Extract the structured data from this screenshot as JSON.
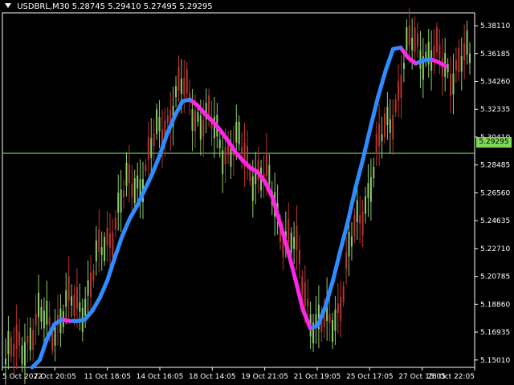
{
  "chart_title": {
    "symbol_period": "USDBRL,M30",
    "ohlc": [
      "5.28745",
      "5.29410",
      "5.27495",
      "5.29295"
    ]
  },
  "current_price_label": "5.29295",
  "colors": {
    "background": "#000000",
    "frame": "#ffffff",
    "bull_candle": "#8ecb6a",
    "bear_candle": "#b7352f",
    "current_line": "#63d85a",
    "indicator_up": "#2f8cff",
    "indicator_down": "#ff27e6",
    "text": "#ffffff"
  },
  "chart_data": {
    "type": "line",
    "title": "USDBRL,M30 5.28745 5.29410 5.27495 5.29295",
    "x": [
      "5 Oct 2022",
      "7 Oct 20:05",
      "11 Oct 18:05",
      "14 Oct 16:05",
      "18 Oct 14:05",
      "19 Oct 21:05",
      "21 Oct 19:05",
      "25 Oct 17:05",
      "27 Oct 15:05",
      "28 Oct 22:05"
    ],
    "y_ticks": [
      "5.38110",
      "5.36185",
      "5.34260",
      "5.32335",
      "5.30410",
      "5.28485",
      "5.26560",
      "5.24635",
      "5.22710",
      "5.20785",
      "5.18860",
      "5.16935",
      "5.15010"
    ],
    "ylim": [
      5.145,
      5.39
    ],
    "current_price": 5.29295,
    "series": [
      {
        "values": [
          5.145,
          5.15,
          5.165,
          5.175,
          5.178,
          5.177,
          5.177,
          5.178,
          5.184,
          5.193,
          5.205,
          5.221,
          5.236,
          5.248,
          5.257,
          5.268,
          5.279,
          5.292,
          5.307,
          5.319,
          5.329,
          5.33,
          5.326,
          5.32,
          5.315,
          5.309,
          5.302,
          5.294,
          5.288,
          5.283,
          5.28,
          5.273,
          5.262,
          5.244,
          5.226,
          5.206,
          5.185,
          5.172,
          5.174,
          5.187,
          5.205,
          5.226,
          5.246,
          5.269,
          5.289,
          5.311,
          5.332,
          5.35,
          5.365,
          5.366,
          5.359,
          5.355,
          5.357,
          5.358,
          5.356,
          5.353
        ]
      }
    ],
    "grid": false,
    "legend": "none"
  }
}
